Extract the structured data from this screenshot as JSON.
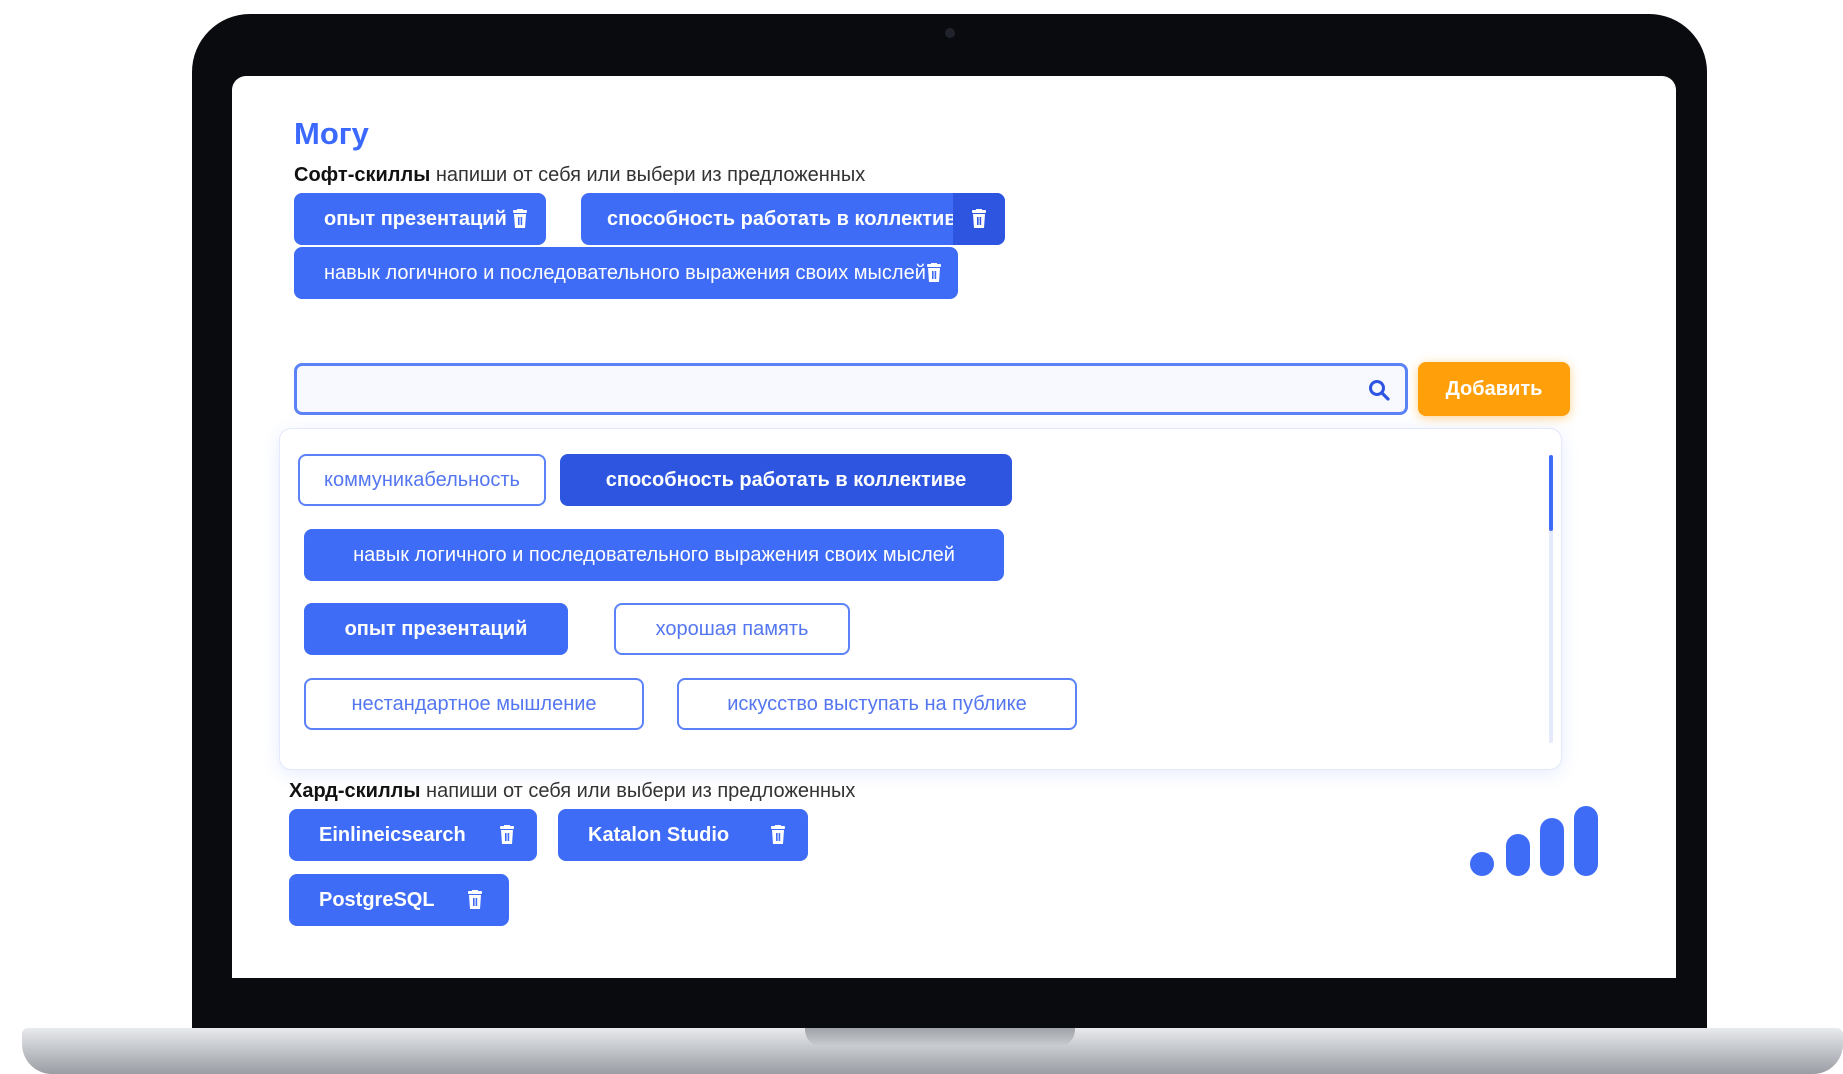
{
  "page": {
    "title": "Могу"
  },
  "soft_skills": {
    "label_bold": "Софт-скиллы",
    "label_rest": " напиши от себя или выбери из предложенных",
    "selected": [
      "опыт презентаций",
      "способность работать в коллективе",
      "навык логичного и последовательного выражения своих мыслей"
    ],
    "search": {
      "value": "",
      "placeholder": ""
    },
    "add_label": "Добавить",
    "suggestions": [
      {
        "label": "коммуникабельность",
        "selected": false
      },
      {
        "label": "способность работать в коллективе",
        "selected": true
      },
      {
        "label": "навык логичного и последовательного выражения своих мыслей",
        "selected": true
      },
      {
        "label": "опыт презентаций",
        "selected": true
      },
      {
        "label": "хорошая память",
        "selected": false
      },
      {
        "label": "нестандартное мышление",
        "selected": false
      },
      {
        "label": "искусство выступать на публике",
        "selected": false
      }
    ]
  },
  "hard_skills": {
    "label_bold": "Хард-скиллы",
    "label_rest": " напиши от себя или выбери из предложенных",
    "selected": [
      "Einlineicsearch",
      "Katalon Studio",
      "PostgreSQL"
    ]
  },
  "icons": {
    "delete": "trash-icon",
    "search": "search-icon",
    "logo": "signal-bars-logo"
  },
  "colors": {
    "accent": "#3f6cf6",
    "accent_dark": "#2d55e0",
    "title": "#3b68ff",
    "add_button": "#ff9f0a"
  }
}
